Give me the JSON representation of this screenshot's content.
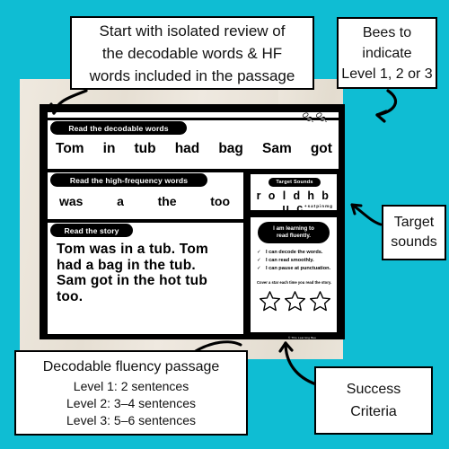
{
  "background": {
    "teal": "#0fbdd3",
    "wood": "#e8e1d6",
    "ink": "#000000"
  },
  "worksheet": {
    "sections": [
      {
        "label": "Read the decodable words",
        "words": [
          "Tom",
          "in",
          "tub",
          "had",
          "bag",
          "Sam",
          "got"
        ]
      },
      {
        "label": "Read the high-frequency words",
        "words": [
          "was",
          "a",
          "the",
          "too"
        ]
      },
      {
        "label": "Read the story",
        "lines": [
          "Tom was in a tub. Tom",
          "had a bag in the tub.",
          "Sam got in the hot tub",
          "too."
        ]
      }
    ],
    "target_sounds": {
      "title": "Target Sounds",
      "letters": "r o l d h b u c",
      "subscript": "+satpinmg"
    },
    "success_criteria": {
      "heading_line1": "I am learning to",
      "heading_line2": "read fluently.",
      "items": [
        "I can decode the words.",
        "I can read smoothly.",
        "I can pause at punctuation."
      ],
      "check_glyph": "✓",
      "note": "Cover a star each time you read the story.",
      "star_count": 3
    },
    "bee_count": 2,
    "copyright": "© This Learning Bee"
  },
  "callouts": {
    "top": {
      "lines": [
        "Start with isolated review of",
        "the decodable words & HF",
        "words included in the passage"
      ]
    },
    "bees": {
      "lines": [
        "Bees to",
        "indicate",
        "Level 1, 2 or 3"
      ]
    },
    "target": {
      "lines": [
        "Target",
        "sounds"
      ]
    },
    "fluency": {
      "title": "Decodable fluency passage",
      "levels": [
        "Level 1: 2 sentences",
        "Level 2: 3–4 sentences",
        "Level 3: 5–6 sentences"
      ]
    },
    "success": {
      "lines": [
        "Success",
        "Criteria"
      ]
    }
  }
}
